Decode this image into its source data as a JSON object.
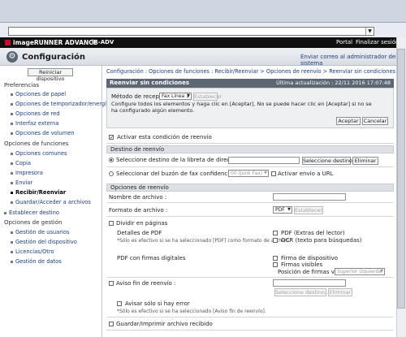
{
  "header": {
    "brand": "imageRUNNER ADVANCE",
    "model": "iR-ADV",
    "portal": "Portal",
    "logout": "Finalizar sesión",
    "title": "Configuración",
    "mail_admin": "Enviar correo al administrador del sistema"
  },
  "sidebar": {
    "reboot": "Reiniciar dispositivo",
    "preferences_title": "Preferencias",
    "preferences": [
      "Opciones de papel",
      "Opciones de temporizador/energía",
      "Opciones de red",
      "Interfaz externa",
      "Opciones de volumen"
    ],
    "functions_title": "Opciones de funciones",
    "functions": [
      "Opciones comunes",
      "Copia",
      "Impresora",
      "Enviar",
      "Recibir/Reenviar",
      "Guardar/Acceder a archivos"
    ],
    "establish_dest": "Establecer destino",
    "management_title": "Opciones de gestión",
    "management": [
      "Gestión de usuarios",
      "Gestión del dispositivo",
      "Licencias/Otro",
      "Gestión de datos"
    ]
  },
  "breadcrumb": "Configuración : Opciones de funciones : Recibir/Reenviar > Opciones de reenvío > Reenviar sin condiciones",
  "page": {
    "title": "Reenviar sin condiciones",
    "updated": "Última actualización : 22/11 2016 17:07:48",
    "reception_method_label": "Método de recepción:",
    "reception_method_value": "Fax Línea 1",
    "establish_btn": "Establecer",
    "instructions": "Configure todos los elementos y haga clic en [Aceptar]. No se puede hacer clic en [Aceptar] si no se ha configurado algún elemento.",
    "accept": "Aceptar",
    "cancel": "Cancelar",
    "activate_condition": "Activar esta condición de reenvío"
  },
  "destination": {
    "header": "Destino de reenvío",
    "select_address_book": "Seleccione destino de la libreta de direcciones",
    "select_dest_btn": "Seleccione destino...",
    "delete_btn": "Eliminar",
    "select_inbox": "Seleccionar del buzón de fax confidencial",
    "inbox_value": "00 (Junk Fax)",
    "activate_url": "Activar envío a URL"
  },
  "forward_options": {
    "header": "Opciones de reenvío",
    "file_name": "Nombre de archivo :",
    "file_format": "Formato de archivo :",
    "format_value": "PDF",
    "establish_btn": "Establecer",
    "split_pages": "Dividir en páginas",
    "pdf_details": "Detalles de PDF",
    "pdf_note": "*Sólo es efectivo si se ha seleccionado [PDF] como formato de archivo.",
    "pdf_extract": "PDF (Extras del lector)",
    "ocr": "OCR (texto para búsquedas)",
    "pdf_signatures": "PDF con firmas digitales",
    "device_sig": "Firma de dispositivo",
    "visible_sig": "Firmas visibles",
    "sig_position_label": "Posición de firmas visibles",
    "sig_position_value": "Superior izquierda",
    "end_notice": "Aviso fin de reenvío :",
    "select_dest_btn": "Seleccione destino...",
    "delete_btn": "Eliminar",
    "notify_error": "Avisar sólo si hay error",
    "notice_note": "*Sólo es efectivo si se ha seleccionado [Aviso fin de reenvío].",
    "save_print": "Guardar/Imprimir archivo recibido"
  }
}
